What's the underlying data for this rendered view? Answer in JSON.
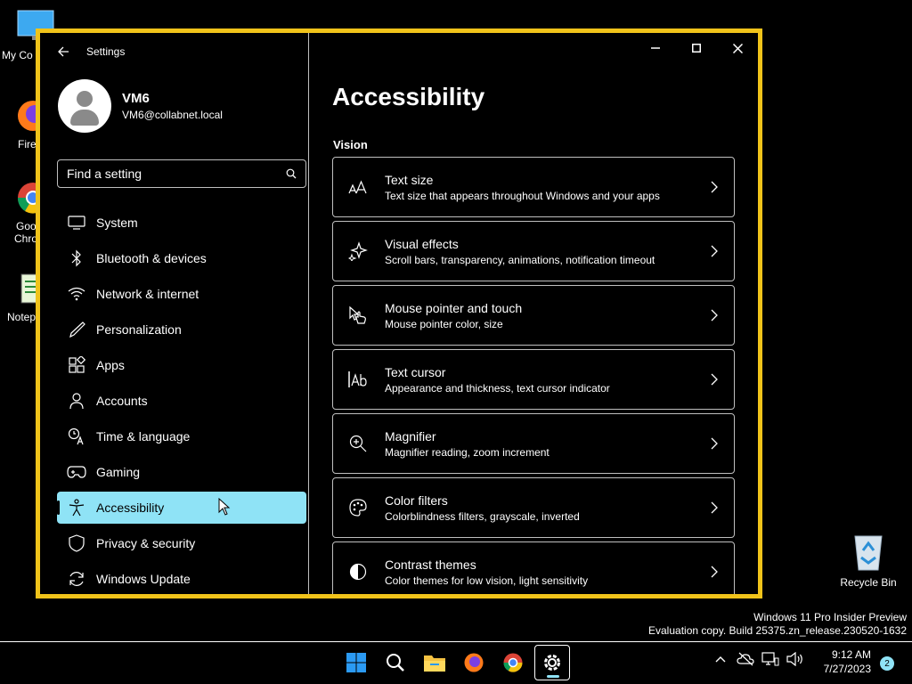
{
  "desktop": {
    "icons": [
      {
        "label": "My Co",
        "icon": "monitor-icon"
      },
      {
        "label": "Fire",
        "icon": "firefox-icon"
      },
      {
        "label": "Goo",
        "label2": "Chro",
        "icon": "chrome-icon"
      },
      {
        "label": "Notep",
        "icon": "notepad-icon"
      }
    ],
    "recycle_bin": {
      "label": "Recycle Bin",
      "icon": "recycle-bin-icon"
    }
  },
  "window": {
    "title": "Settings",
    "border_color": "#f0c31a",
    "controls": [
      "minimize-icon",
      "maximize-icon",
      "close-icon"
    ]
  },
  "profile": {
    "name": "VM6",
    "email": "VM6@collabnet.local"
  },
  "search": {
    "placeholder": "Find a setting"
  },
  "nav": {
    "items": [
      {
        "label": "System",
        "icon": "monitor-icon"
      },
      {
        "label": "Bluetooth & devices",
        "icon": "bluetooth-icon"
      },
      {
        "label": "Network & internet",
        "icon": "wifi-icon"
      },
      {
        "label": "Personalization",
        "icon": "pen-icon"
      },
      {
        "label": "Apps",
        "icon": "apps-icon"
      },
      {
        "label": "Accounts",
        "icon": "person-icon"
      },
      {
        "label": "Time & language",
        "icon": "clock-language-icon"
      },
      {
        "label": "Gaming",
        "icon": "gamepad-icon"
      },
      {
        "label": "Accessibility",
        "icon": "accessibility-icon",
        "active": true
      },
      {
        "label": "Privacy & security",
        "icon": "shield-icon"
      },
      {
        "label": "Windows Update",
        "icon": "update-icon"
      }
    ],
    "accent": "#8fe3f6"
  },
  "main": {
    "title": "Accessibility",
    "section": "Vision",
    "cards": [
      {
        "title": "Text size",
        "desc": "Text size that appears throughout Windows and your apps",
        "icon": "text-size-icon"
      },
      {
        "title": "Visual effects",
        "desc": "Scroll bars, transparency, animations, notification timeout",
        "icon": "sparkle-icon"
      },
      {
        "title": "Mouse pointer and touch",
        "desc": "Mouse pointer color, size",
        "icon": "pointer-touch-icon"
      },
      {
        "title": "Text cursor",
        "desc": "Appearance and thickness, text cursor indicator",
        "icon": "text-cursor-icon"
      },
      {
        "title": "Magnifier",
        "desc": "Magnifier reading, zoom increment",
        "icon": "magnifier-icon"
      },
      {
        "title": "Color filters",
        "desc": "Colorblindness filters, grayscale, inverted",
        "icon": "palette-icon"
      },
      {
        "title": "Contrast themes",
        "desc": "Color themes for low vision, light sensitivity",
        "icon": "contrast-icon"
      }
    ]
  },
  "watermark": {
    "line1": "Windows 11 Pro Insider Preview",
    "line2": "Evaluation copy. Build 25375.zn_release.230520-1632"
  },
  "taskbar": {
    "apps": [
      "windows-start-icon",
      "search-icon",
      "file-explorer-icon",
      "firefox-icon",
      "chrome-icon",
      "settings-gear-icon"
    ],
    "time": "9:12 AM",
    "date": "7/27/2023",
    "notifications": "2"
  }
}
